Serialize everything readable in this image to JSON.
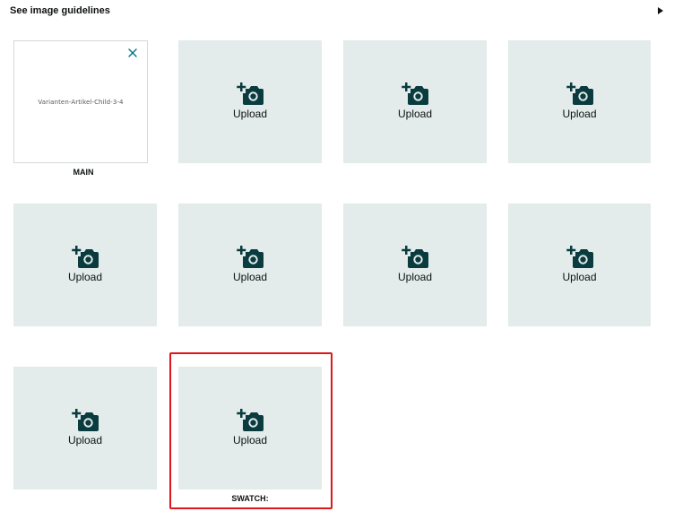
{
  "header": {
    "guidelines_link": "See image guidelines",
    "expand_icon": "triangle-right-icon"
  },
  "main_slot": {
    "image_name": "Varianten-Artikel-Child-3-4",
    "caption": "MAIN",
    "remove_icon": "close-icon"
  },
  "upload_label": "Upload",
  "upload_icon": "camera-plus-icon",
  "swatch_caption": "SWATCH:",
  "colors": {
    "slot_background": "#e3ebeb",
    "icon_color": "#0a3b3f",
    "close_icon_color": "#007185",
    "highlight_border": "#e0161b"
  }
}
